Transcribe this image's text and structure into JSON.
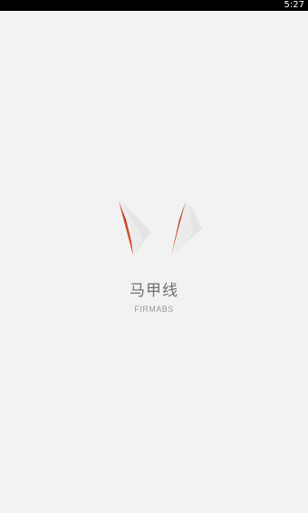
{
  "status_bar": {
    "time": "5:27"
  },
  "splash": {
    "logo_icon": "fang-logo-icon",
    "app_name": "马甲线",
    "app_subtitle": "FIRMABS"
  },
  "colors": {
    "background": "#f2f2f2",
    "status_bar": "#000000",
    "accent": "#d9482b",
    "accent_dark": "#b5351d",
    "text_primary": "#6f6f6f",
    "text_secondary": "#9a9a9a"
  }
}
